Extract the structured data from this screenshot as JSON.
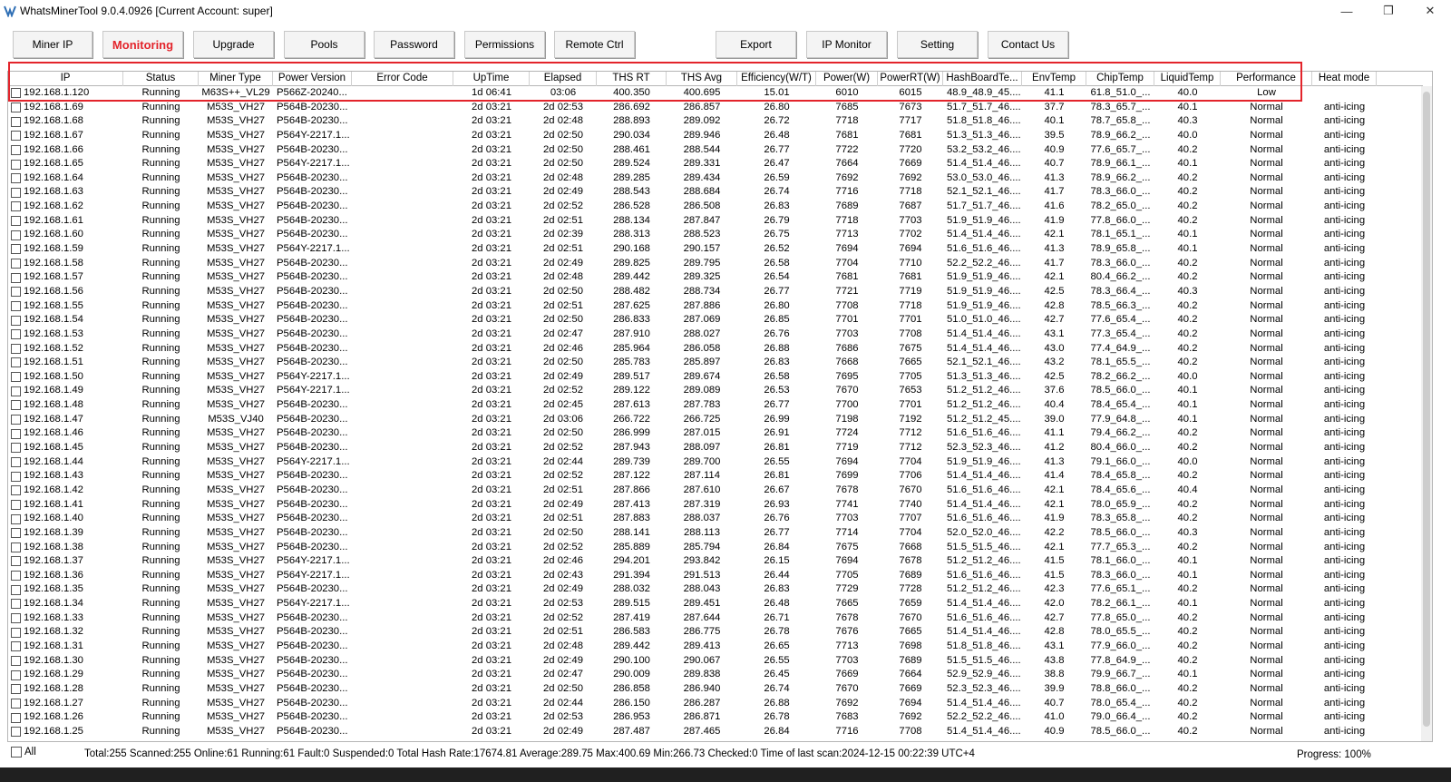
{
  "window": {
    "title": "WhatsMinerTool 9.0.4.0926 [Current Account: super]",
    "controls": [
      "—",
      "❐",
      "✕"
    ]
  },
  "toolbar": {
    "buttons": [
      "Miner IP",
      "Monitoring",
      "Upgrade",
      "Pools",
      "Password",
      "Permissions",
      "Remote Ctrl",
      "Export",
      "IP Monitor",
      "Setting",
      "Contact Us"
    ],
    "active": "Monitoring",
    "active_color": "#e3242b"
  },
  "table": {
    "columns": [
      "IP",
      "Status",
      "Miner Type",
      "Power Version",
      "Error Code",
      "UpTime",
      "Elapsed",
      "THS RT",
      "THS Avg",
      "Efficiency(W/T)",
      "Power(W)",
      "PowerRT(W)",
      "HashBoardTe...",
      "EnvTemp",
      "ChipTemp",
      "LiquidTemp",
      "Performance",
      "Heat mode"
    ],
    "rows": [
      [
        "192.168.1.120",
        "Running",
        "M63S++_VL29",
        "P566Z-20240...",
        "",
        "1d 06:41",
        "03:06",
        "400.350",
        "400.695",
        "15.01",
        "6010",
        "6015",
        "48.9_48.9_45....",
        "41.1",
        "61.8_51.0_...",
        "40.0",
        "Low",
        ""
      ],
      [
        "192.168.1.69",
        "Running",
        "M53S_VH27",
        "P564B-20230...",
        "",
        "2d 03:21",
        "2d 02:53",
        "286.692",
        "286.857",
        "26.80",
        "7685",
        "7673",
        "51.7_51.7_46....",
        "37.7",
        "78.3_65.7_...",
        "40.1",
        "Normal",
        "anti-icing"
      ],
      [
        "192.168.1.68",
        "Running",
        "M53S_VH27",
        "P564B-20230...",
        "",
        "2d 03:21",
        "2d 02:48",
        "288.893",
        "289.092",
        "26.72",
        "7718",
        "7717",
        "51.8_51.8_46....",
        "40.1",
        "78.7_65.8_...",
        "40.3",
        "Normal",
        "anti-icing"
      ],
      [
        "192.168.1.67",
        "Running",
        "M53S_VH27",
        "P564Y-2217.1...",
        "",
        "2d 03:21",
        "2d 02:50",
        "290.034",
        "289.946",
        "26.48",
        "7681",
        "7681",
        "51.3_51.3_46....",
        "39.5",
        "78.9_66.2_...",
        "40.0",
        "Normal",
        "anti-icing"
      ],
      [
        "192.168.1.66",
        "Running",
        "M53S_VH27",
        "P564B-20230...",
        "",
        "2d 03:21",
        "2d 02:50",
        "288.461",
        "288.544",
        "26.77",
        "7722",
        "7720",
        "53.2_53.2_46....",
        "40.9",
        "77.6_65.7_...",
        "40.2",
        "Normal",
        "anti-icing"
      ],
      [
        "192.168.1.65",
        "Running",
        "M53S_VH27",
        "P564Y-2217.1...",
        "",
        "2d 03:21",
        "2d 02:50",
        "289.524",
        "289.331",
        "26.47",
        "7664",
        "7669",
        "51.4_51.4_46....",
        "40.7",
        "78.9_66.1_...",
        "40.1",
        "Normal",
        "anti-icing"
      ],
      [
        "192.168.1.64",
        "Running",
        "M53S_VH27",
        "P564B-20230...",
        "",
        "2d 03:21",
        "2d 02:48",
        "289.285",
        "289.434",
        "26.59",
        "7692",
        "7692",
        "53.0_53.0_46....",
        "41.3",
        "78.9_66.2_...",
        "40.2",
        "Normal",
        "anti-icing"
      ],
      [
        "192.168.1.63",
        "Running",
        "M53S_VH27",
        "P564B-20230...",
        "",
        "2d 03:21",
        "2d 02:49",
        "288.543",
        "288.684",
        "26.74",
        "7716",
        "7718",
        "52.1_52.1_46....",
        "41.7",
        "78.3_66.0_...",
        "40.2",
        "Normal",
        "anti-icing"
      ],
      [
        "192.168.1.62",
        "Running",
        "M53S_VH27",
        "P564B-20230...",
        "",
        "2d 03:21",
        "2d 02:52",
        "286.528",
        "286.508",
        "26.83",
        "7689",
        "7687",
        "51.7_51.7_46....",
        "41.6",
        "78.2_65.0_...",
        "40.2",
        "Normal",
        "anti-icing"
      ],
      [
        "192.168.1.61",
        "Running",
        "M53S_VH27",
        "P564B-20230...",
        "",
        "2d 03:21",
        "2d 02:51",
        "288.134",
        "287.847",
        "26.79",
        "7718",
        "7703",
        "51.9_51.9_46....",
        "41.9",
        "77.8_66.0_...",
        "40.2",
        "Normal",
        "anti-icing"
      ],
      [
        "192.168.1.60",
        "Running",
        "M53S_VH27",
        "P564B-20230...",
        "",
        "2d 03:21",
        "2d 02:39",
        "288.313",
        "288.523",
        "26.75",
        "7713",
        "7702",
        "51.4_51.4_46....",
        "42.1",
        "78.1_65.1_...",
        "40.1",
        "Normal",
        "anti-icing"
      ],
      [
        "192.168.1.59",
        "Running",
        "M53S_VH27",
        "P564Y-2217.1...",
        "",
        "2d 03:21",
        "2d 02:51",
        "290.168",
        "290.157",
        "26.52",
        "7694",
        "7694",
        "51.6_51.6_46....",
        "41.3",
        "78.9_65.8_...",
        "40.1",
        "Normal",
        "anti-icing"
      ],
      [
        "192.168.1.58",
        "Running",
        "M53S_VH27",
        "P564B-20230...",
        "",
        "2d 03:21",
        "2d 02:49",
        "289.825",
        "289.795",
        "26.58",
        "7704",
        "7710",
        "52.2_52.2_46....",
        "41.7",
        "78.3_66.0_...",
        "40.2",
        "Normal",
        "anti-icing"
      ],
      [
        "192.168.1.57",
        "Running",
        "M53S_VH27",
        "P564B-20230...",
        "",
        "2d 03:21",
        "2d 02:48",
        "289.442",
        "289.325",
        "26.54",
        "7681",
        "7681",
        "51.9_51.9_46....",
        "42.1",
        "80.4_66.2_...",
        "40.2",
        "Normal",
        "anti-icing"
      ],
      [
        "192.168.1.56",
        "Running",
        "M53S_VH27",
        "P564B-20230...",
        "",
        "2d 03:21",
        "2d 02:50",
        "288.482",
        "288.734",
        "26.77",
        "7721",
        "7719",
        "51.9_51.9_46....",
        "42.5",
        "78.3_66.4_...",
        "40.3",
        "Normal",
        "anti-icing"
      ],
      [
        "192.168.1.55",
        "Running",
        "M53S_VH27",
        "P564B-20230...",
        "",
        "2d 03:21",
        "2d 02:51",
        "287.625",
        "287.886",
        "26.80",
        "7708",
        "7718",
        "51.9_51.9_46....",
        "42.8",
        "78.5_66.3_...",
        "40.2",
        "Normal",
        "anti-icing"
      ],
      [
        "192.168.1.54",
        "Running",
        "M53S_VH27",
        "P564B-20230...",
        "",
        "2d 03:21",
        "2d 02:50",
        "286.833",
        "287.069",
        "26.85",
        "7701",
        "7701",
        "51.0_51.0_46....",
        "42.7",
        "77.6_65.4_...",
        "40.2",
        "Normal",
        "anti-icing"
      ],
      [
        "192.168.1.53",
        "Running",
        "M53S_VH27",
        "P564B-20230...",
        "",
        "2d 03:21",
        "2d 02:47",
        "287.910",
        "288.027",
        "26.76",
        "7703",
        "7708",
        "51.4_51.4_46....",
        "43.1",
        "77.3_65.4_...",
        "40.2",
        "Normal",
        "anti-icing"
      ],
      [
        "192.168.1.52",
        "Running",
        "M53S_VH27",
        "P564B-20230...",
        "",
        "2d 03:21",
        "2d 02:46",
        "285.964",
        "286.058",
        "26.88",
        "7686",
        "7675",
        "51.4_51.4_46....",
        "43.0",
        "77.4_64.9_...",
        "40.2",
        "Normal",
        "anti-icing"
      ],
      [
        "192.168.1.51",
        "Running",
        "M53S_VH27",
        "P564B-20230...",
        "",
        "2d 03:21",
        "2d 02:50",
        "285.783",
        "285.897",
        "26.83",
        "7668",
        "7665",
        "52.1_52.1_46....",
        "43.2",
        "78.1_65.5_...",
        "40.2",
        "Normal",
        "anti-icing"
      ],
      [
        "192.168.1.50",
        "Running",
        "M53S_VH27",
        "P564Y-2217.1...",
        "",
        "2d 03:21",
        "2d 02:49",
        "289.517",
        "289.674",
        "26.58",
        "7695",
        "7705",
        "51.3_51.3_46....",
        "42.5",
        "78.2_66.2_...",
        "40.0",
        "Normal",
        "anti-icing"
      ],
      [
        "192.168.1.49",
        "Running",
        "M53S_VH27",
        "P564Y-2217.1...",
        "",
        "2d 03:21",
        "2d 02:52",
        "289.122",
        "289.089",
        "26.53",
        "7670",
        "7653",
        "51.2_51.2_46....",
        "37.6",
        "78.5_66.0_...",
        "40.1",
        "Normal",
        "anti-icing"
      ],
      [
        "192.168.1.48",
        "Running",
        "M53S_VH27",
        "P564B-20230...",
        "",
        "2d 03:21",
        "2d 02:45",
        "287.613",
        "287.783",
        "26.77",
        "7700",
        "7701",
        "51.2_51.2_46....",
        "40.4",
        "78.4_65.4_...",
        "40.1",
        "Normal",
        "anti-icing"
      ],
      [
        "192.168.1.47",
        "Running",
        "M53S_VJ40",
        "P564B-20230...",
        "",
        "2d 03:21",
        "2d 03:06",
        "266.722",
        "266.725",
        "26.99",
        "7198",
        "7192",
        "51.2_51.2_45....",
        "39.0",
        "77.9_64.8_...",
        "40.1",
        "Normal",
        "anti-icing"
      ],
      [
        "192.168.1.46",
        "Running",
        "M53S_VH27",
        "P564B-20230...",
        "",
        "2d 03:21",
        "2d 02:50",
        "286.999",
        "287.015",
        "26.91",
        "7724",
        "7712",
        "51.6_51.6_46....",
        "41.1",
        "79.4_66.2_...",
        "40.2",
        "Normal",
        "anti-icing"
      ],
      [
        "192.168.1.45",
        "Running",
        "M53S_VH27",
        "P564B-20230...",
        "",
        "2d 03:21",
        "2d 02:52",
        "287.943",
        "288.097",
        "26.81",
        "7719",
        "7712",
        "52.3_52.3_46....",
        "41.2",
        "80.4_66.0_...",
        "40.2",
        "Normal",
        "anti-icing"
      ],
      [
        "192.168.1.44",
        "Running",
        "M53S_VH27",
        "P564Y-2217.1...",
        "",
        "2d 03:21",
        "2d 02:44",
        "289.739",
        "289.700",
        "26.55",
        "7694",
        "7704",
        "51.9_51.9_46....",
        "41.3",
        "79.1_66.0_...",
        "40.0",
        "Normal",
        "anti-icing"
      ],
      [
        "192.168.1.43",
        "Running",
        "M53S_VH27",
        "P564B-20230...",
        "",
        "2d 03:21",
        "2d 02:52",
        "287.122",
        "287.114",
        "26.81",
        "7699",
        "7706",
        "51.4_51.4_46....",
        "41.4",
        "78.4_65.8_...",
        "40.2",
        "Normal",
        "anti-icing"
      ],
      [
        "192.168.1.42",
        "Running",
        "M53S_VH27",
        "P564B-20230...",
        "",
        "2d 03:21",
        "2d 02:51",
        "287.866",
        "287.610",
        "26.67",
        "7678",
        "7670",
        "51.6_51.6_46....",
        "42.1",
        "78.4_65.6_...",
        "40.4",
        "Normal",
        "anti-icing"
      ],
      [
        "192.168.1.41",
        "Running",
        "M53S_VH27",
        "P564B-20230...",
        "",
        "2d 03:21",
        "2d 02:49",
        "287.413",
        "287.319",
        "26.93",
        "7741",
        "7740",
        "51.4_51.4_46....",
        "42.1",
        "78.0_65.9_...",
        "40.2",
        "Normal",
        "anti-icing"
      ],
      [
        "192.168.1.40",
        "Running",
        "M53S_VH27",
        "P564B-20230...",
        "",
        "2d 03:21",
        "2d 02:51",
        "287.883",
        "288.037",
        "26.76",
        "7703",
        "7707",
        "51.6_51.6_46....",
        "41.9",
        "78.3_65.8_...",
        "40.2",
        "Normal",
        "anti-icing"
      ],
      [
        "192.168.1.39",
        "Running",
        "M53S_VH27",
        "P564B-20230...",
        "",
        "2d 03:21",
        "2d 02:50",
        "288.141",
        "288.113",
        "26.77",
        "7714",
        "7704",
        "52.0_52.0_46....",
        "42.2",
        "78.5_66.0_...",
        "40.3",
        "Normal",
        "anti-icing"
      ],
      [
        "192.168.1.38",
        "Running",
        "M53S_VH27",
        "P564B-20230...",
        "",
        "2d 03:21",
        "2d 02:52",
        "285.889",
        "285.794",
        "26.84",
        "7675",
        "7668",
        "51.5_51.5_46....",
        "42.1",
        "77.7_65.3_...",
        "40.2",
        "Normal",
        "anti-icing"
      ],
      [
        "192.168.1.37",
        "Running",
        "M53S_VH27",
        "P564Y-2217.1...",
        "",
        "2d 03:21",
        "2d 02:46",
        "294.201",
        "293.842",
        "26.15",
        "7694",
        "7678",
        "51.2_51.2_46....",
        "41.5",
        "78.1_66.0_...",
        "40.1",
        "Normal",
        "anti-icing"
      ],
      [
        "192.168.1.36",
        "Running",
        "M53S_VH27",
        "P564Y-2217.1...",
        "",
        "2d 03:21",
        "2d 02:43",
        "291.394",
        "291.513",
        "26.44",
        "7705",
        "7689",
        "51.6_51.6_46....",
        "41.5",
        "78.3_66.0_...",
        "40.1",
        "Normal",
        "anti-icing"
      ],
      [
        "192.168.1.35",
        "Running",
        "M53S_VH27",
        "P564B-20230...",
        "",
        "2d 03:21",
        "2d 02:49",
        "288.032",
        "288.043",
        "26.83",
        "7729",
        "7728",
        "51.2_51.2_46....",
        "42.3",
        "77.6_65.1_...",
        "40.2",
        "Normal",
        "anti-icing"
      ],
      [
        "192.168.1.34",
        "Running",
        "M53S_VH27",
        "P564Y-2217.1...",
        "",
        "2d 03:21",
        "2d 02:53",
        "289.515",
        "289.451",
        "26.48",
        "7665",
        "7659",
        "51.4_51.4_46....",
        "42.0",
        "78.2_66.1_...",
        "40.1",
        "Normal",
        "anti-icing"
      ],
      [
        "192.168.1.33",
        "Running",
        "M53S_VH27",
        "P564B-20230...",
        "",
        "2d 03:21",
        "2d 02:52",
        "287.419",
        "287.644",
        "26.71",
        "7678",
        "7670",
        "51.6_51.6_46....",
        "42.7",
        "77.8_65.0_...",
        "40.2",
        "Normal",
        "anti-icing"
      ],
      [
        "192.168.1.32",
        "Running",
        "M53S_VH27",
        "P564B-20230...",
        "",
        "2d 03:21",
        "2d 02:51",
        "286.583",
        "286.775",
        "26.78",
        "7676",
        "7665",
        "51.4_51.4_46....",
        "42.8",
        "78.0_65.5_...",
        "40.2",
        "Normal",
        "anti-icing"
      ],
      [
        "192.168.1.31",
        "Running",
        "M53S_VH27",
        "P564B-20230...",
        "",
        "2d 03:21",
        "2d 02:48",
        "289.442",
        "289.413",
        "26.65",
        "7713",
        "7698",
        "51.8_51.8_46....",
        "43.1",
        "77.9_66.0_...",
        "40.2",
        "Normal",
        "anti-icing"
      ],
      [
        "192.168.1.30",
        "Running",
        "M53S_VH27",
        "P564B-20230...",
        "",
        "2d 03:21",
        "2d 02:49",
        "290.100",
        "290.067",
        "26.55",
        "7703",
        "7689",
        "51.5_51.5_46....",
        "43.8",
        "77.8_64.9_...",
        "40.2",
        "Normal",
        "anti-icing"
      ],
      [
        "192.168.1.29",
        "Running",
        "M53S_VH27",
        "P564B-20230...",
        "",
        "2d 03:21",
        "2d 02:47",
        "290.009",
        "289.838",
        "26.45",
        "7669",
        "7664",
        "52.9_52.9_46....",
        "38.8",
        "79.9_66.7_...",
        "40.1",
        "Normal",
        "anti-icing"
      ],
      [
        "192.168.1.28",
        "Running",
        "M53S_VH27",
        "P564B-20230...",
        "",
        "2d 03:21",
        "2d 02:50",
        "286.858",
        "286.940",
        "26.74",
        "7670",
        "7669",
        "52.3_52.3_46....",
        "39.9",
        "78.8_66.0_...",
        "40.2",
        "Normal",
        "anti-icing"
      ],
      [
        "192.168.1.27",
        "Running",
        "M53S_VH27",
        "P564B-20230...",
        "",
        "2d 03:21",
        "2d 02:44",
        "286.150",
        "286.287",
        "26.88",
        "7692",
        "7694",
        "51.4_51.4_46....",
        "40.7",
        "78.0_65.4_...",
        "40.2",
        "Normal",
        "anti-icing"
      ],
      [
        "192.168.1.26",
        "Running",
        "M53S_VH27",
        "P564B-20230...",
        "",
        "2d 03:21",
        "2d 02:53",
        "286.953",
        "286.871",
        "26.78",
        "7683",
        "7692",
        "52.2_52.2_46....",
        "41.0",
        "79.0_66.4_...",
        "40.2",
        "Normal",
        "anti-icing"
      ],
      [
        "192.168.1.25",
        "Running",
        "M53S_VH27",
        "P564B-20230...",
        "",
        "2d 03:21",
        "2d 02:49",
        "287.487",
        "287.465",
        "26.84",
        "7716",
        "7708",
        "51.4_51.4_46....",
        "40.9",
        "78.5_66.0_...",
        "40.2",
        "Normal",
        "anti-icing"
      ]
    ]
  },
  "status": {
    "all_label": "All",
    "summary": "Total:255  Scanned:255  Online:61  Running:61  Fault:0  Suspended:0  Total Hash Rate:17674.81  Average:289.75  Max:400.69  Min:266.73  Checked:0  Time of last scan:2024-12-15 00:22:39 UTC+4",
    "progress": "Progress: 100%"
  },
  "colors": {
    "highlight": "#e3242b"
  }
}
